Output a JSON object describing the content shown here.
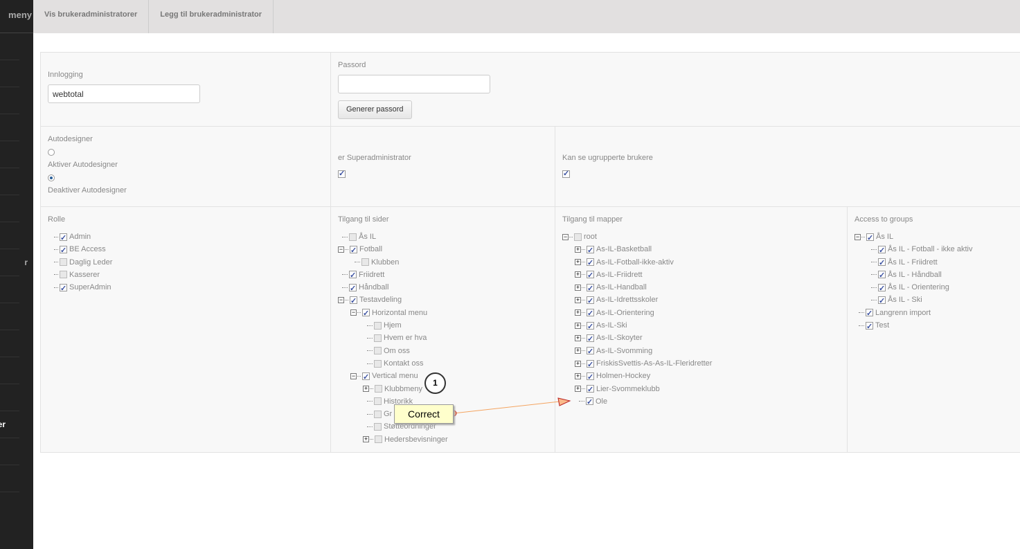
{
  "sidebar": {
    "title": "meny",
    "items": [
      "",
      "",
      "",
      "",
      "",
      "",
      "",
      "",
      "r",
      "",
      "",
      "",
      "",
      "",
      "anger",
      "",
      ""
    ]
  },
  "topbar": {
    "tabs": [
      "Vis brukeradministratorer",
      "Legg til brukeradministrator"
    ]
  },
  "form": {
    "login_label": "Innlogging",
    "login_value": "webtotal",
    "password_label": "Passord",
    "password_value": "",
    "generate_label": "Generer passord",
    "autodesigner_label": "Autodesigner",
    "autodesigner_options": [
      "Aktiver Autodesigner",
      "Deaktiver Autodesigner"
    ],
    "autodesigner_selected": "Deaktiver Autodesigner",
    "superadmin_label": "er Superadministrator",
    "superadmin_checked": true,
    "ungrouped_label": "Kan se ugrupperte brukere",
    "ungrouped_checked": true
  },
  "roles": {
    "label": "Rolle",
    "items": [
      {
        "t": "Admin",
        "c": true
      },
      {
        "t": "BE Access",
        "c": true
      },
      {
        "t": "Daglig Leder",
        "c": false
      },
      {
        "t": "Kasserer",
        "c": false
      },
      {
        "t": "SuperAdmin",
        "c": true
      }
    ]
  },
  "pages": {
    "label": "Tilgang til sider",
    "items": [
      {
        "t": "Ås IL",
        "c": false,
        "d": 0
      },
      {
        "t": "Fotball",
        "c": true,
        "d": 0,
        "e": "-"
      },
      {
        "t": "Klubben",
        "c": false,
        "d": 1
      },
      {
        "t": "Friidrett",
        "c": true,
        "d": 0
      },
      {
        "t": "Håndball",
        "c": true,
        "d": 0
      },
      {
        "t": "Testavdeling",
        "c": true,
        "d": 0,
        "e": "-"
      },
      {
        "t": "Horizontal menu",
        "c": true,
        "d": 1,
        "e": "-"
      },
      {
        "t": "Hjem",
        "c": false,
        "d": 2
      },
      {
        "t": "Hvem er hva",
        "c": false,
        "d": 2
      },
      {
        "t": "Om oss",
        "c": false,
        "d": 2
      },
      {
        "t": "Kontakt oss",
        "c": false,
        "d": 2
      },
      {
        "t": "Vertical menu",
        "c": true,
        "d": 1,
        "e": "-"
      },
      {
        "t": "Klubbmeny",
        "c": false,
        "d": 2,
        "e": "+"
      },
      {
        "t": "Historikk",
        "c": false,
        "d": 2
      },
      {
        "t": "Gr",
        "c": false,
        "d": 2
      },
      {
        "t": "Støtteordninger",
        "c": false,
        "d": 2
      },
      {
        "t": "Hedersbevisninger",
        "c": false,
        "d": 2,
        "e": "+"
      }
    ]
  },
  "folders": {
    "label": "Tilgang til mapper",
    "items": [
      {
        "t": "root",
        "c": false,
        "d": 0,
        "e": "-"
      },
      {
        "t": "As-IL-Basketball",
        "c": true,
        "d": 1,
        "e": "+"
      },
      {
        "t": "As-IL-Fotball-ikke-aktiv",
        "c": true,
        "d": 1,
        "e": "+"
      },
      {
        "t": "As-IL-Friidrett",
        "c": true,
        "d": 1,
        "e": "+"
      },
      {
        "t": "As-IL-Handball",
        "c": true,
        "d": 1,
        "e": "+"
      },
      {
        "t": "As-IL-Idrettsskoler",
        "c": true,
        "d": 1,
        "e": "+"
      },
      {
        "t": "As-IL-Orientering",
        "c": true,
        "d": 1,
        "e": "+"
      },
      {
        "t": "As-IL-Ski",
        "c": true,
        "d": 1,
        "e": "+"
      },
      {
        "t": "As-IL-Skoyter",
        "c": true,
        "d": 1,
        "e": "+"
      },
      {
        "t": "As-IL-Svomming",
        "c": true,
        "d": 1,
        "e": "+"
      },
      {
        "t": "FriskisSvettis-As-As-IL-Fleridretter",
        "c": true,
        "d": 1,
        "e": "+"
      },
      {
        "t": "Holmen-Hockey",
        "c": true,
        "d": 1,
        "e": "+"
      },
      {
        "t": "Lier-Svommeklubb",
        "c": true,
        "d": 1,
        "e": "+"
      },
      {
        "t": "Ole",
        "c": true,
        "d": 1
      }
    ]
  },
  "groups": {
    "label": "Access to groups",
    "items": [
      {
        "t": "Ås IL",
        "c": true,
        "d": 0,
        "e": "-"
      },
      {
        "t": "Ås IL - Fotball - ikke aktiv",
        "c": true,
        "d": 1
      },
      {
        "t": "Ås IL - Friidrett",
        "c": true,
        "d": 1
      },
      {
        "t": "Ås IL - Håndball",
        "c": true,
        "d": 1
      },
      {
        "t": "Ås IL - Orientering",
        "c": true,
        "d": 1
      },
      {
        "t": "Ås IL - Ski",
        "c": true,
        "d": 1
      },
      {
        "t": "Langrenn import",
        "c": true,
        "d": 0
      },
      {
        "t": "Test",
        "c": true,
        "d": 0
      }
    ]
  },
  "annotation": {
    "number": "1",
    "label": "Correct",
    "color": "#f4a460"
  }
}
